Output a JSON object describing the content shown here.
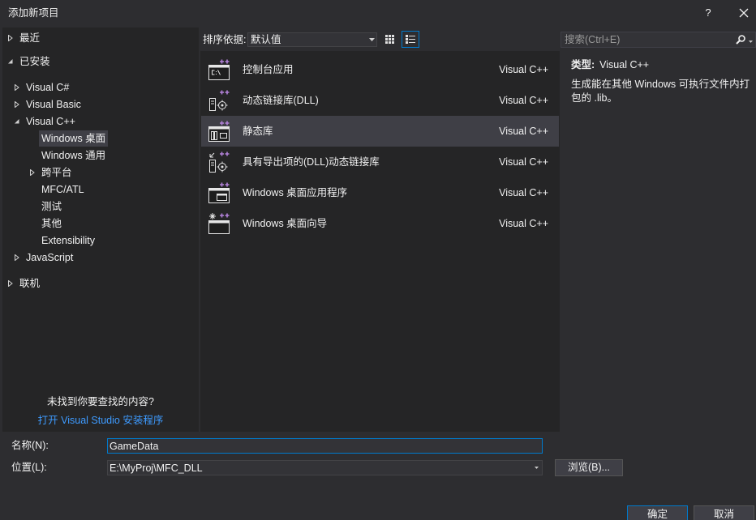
{
  "window": {
    "title": "添加新项目",
    "help_label": "?"
  },
  "sidebar": {
    "tree": [
      {
        "label": "最近",
        "icon": "collapsed-arrow-icon"
      },
      {
        "label": "已安装",
        "icon": "expanded-arrow-icon"
      },
      {
        "label": "Visual C#",
        "icon": "collapsed-arrow-icon"
      },
      {
        "label": "Visual Basic",
        "icon": "collapsed-arrow-icon"
      },
      {
        "label": "Visual C++",
        "icon": "expanded-arrow-icon"
      },
      {
        "label": "Windows 桌面",
        "selected": true
      },
      {
        "label": "Windows 通用"
      },
      {
        "label": "跨平台",
        "icon": "collapsed-arrow-icon"
      },
      {
        "label": "MFC/ATL"
      },
      {
        "label": "测试"
      },
      {
        "label": "其他"
      },
      {
        "label": "Extensibility"
      },
      {
        "label": "JavaScript",
        "icon": "collapsed-arrow-icon"
      },
      {
        "label": "联机",
        "icon": "collapsed-arrow-icon"
      }
    ],
    "not_found_text": "未找到你要查找的内容?",
    "installer_link": "打开 Visual Studio 安装程序"
  },
  "toolbar": {
    "sort_label": "排序依据:",
    "sort_value": "默认值",
    "active_view_icon": "list-view-icon"
  },
  "search": {
    "placeholder": "搜索(Ctrl+E)"
  },
  "templates": [
    {
      "name": "控制台应用",
      "language": "Visual C++",
      "icon": "console-app-icon"
    },
    {
      "name": "动态链接库(DLL)",
      "language": "Visual C++",
      "icon": "dll-icon"
    },
    {
      "name": "静态库",
      "language": "Visual C++",
      "icon": "static-library-icon",
      "selected": true
    },
    {
      "name": "具有导出项的(DLL)动态链接库",
      "language": "Visual C++",
      "icon": "dll-exports-icon"
    },
    {
      "name": "Windows 桌面应用程序",
      "language": "Visual C++",
      "icon": "desktop-app-icon"
    },
    {
      "name": "Windows 桌面向导",
      "language": "Visual C++",
      "icon": "desktop-wizard-icon"
    }
  ],
  "details": {
    "type_label": "类型:",
    "type_value": "Visual C++",
    "description": "生成能在其他 Windows 可执行文件内打包的 .lib。"
  },
  "form": {
    "name_label": "名称(N):",
    "name_value": "GameData",
    "location_label": "位置(L):",
    "location_value": "E:\\MyProj\\MFC_DLL",
    "browse_label": "浏览(B)..."
  },
  "buttons": {
    "ok": "确定",
    "cancel": "取消"
  },
  "colors": {
    "accent": "#007acc",
    "selection": "#3f3f46",
    "link": "#3e9bff",
    "template_plus": "#b180d7"
  }
}
